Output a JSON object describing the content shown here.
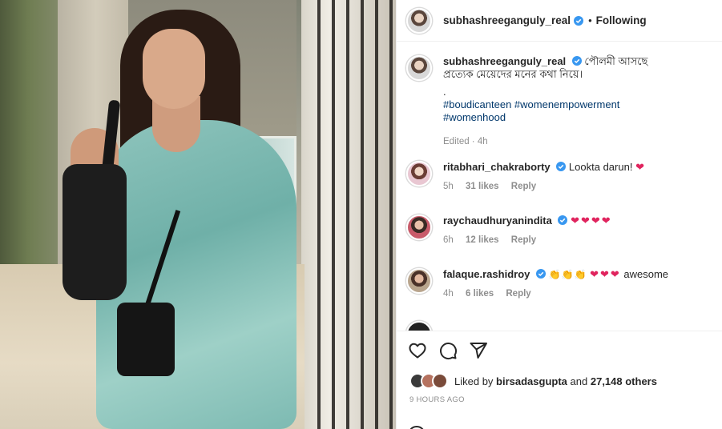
{
  "post": {
    "username": "subhashreeganguly_real",
    "following_label": "Following",
    "caption": {
      "line1": "পৌলমী আসছে",
      "line2": "প্রত্যেক মেয়েদের মনের কথা নিয়ে।",
      "dot": ".",
      "hashtags_line1": "#boudicanteen #womenempowerment",
      "hashtags_line2": "#womenhood",
      "meta": "Edited · 4h"
    }
  },
  "comments": [
    {
      "username": "ritabhari_chakraborty",
      "text": "Lookta darun!",
      "emoji": "❤",
      "age": "5h",
      "likes": "31 likes",
      "reply": "Reply"
    },
    {
      "username": "raychaudhuryanindita",
      "text": "",
      "emoji": "❤❤❤❤",
      "age": "6h",
      "likes": "12 likes",
      "reply": "Reply"
    },
    {
      "username": "falaque.rashidroy",
      "text": "awesome",
      "emoji_clap": "👏👏👏",
      "emoji": "❤❤❤",
      "age": "4h",
      "likes": "6 likes",
      "reply": "Reply"
    }
  ],
  "actions": {
    "liked_by_prefix": "Liked by",
    "liked_by_user": "birsadasgupta",
    "liked_by_suffix": "and",
    "others_count": "27,148 others",
    "time_ago": "9 HOURS AGO"
  },
  "colors": {
    "verified": "#3897f0",
    "heart": "#e0245e",
    "hashtag": "#00376b",
    "muted": "#8e8e8e"
  }
}
